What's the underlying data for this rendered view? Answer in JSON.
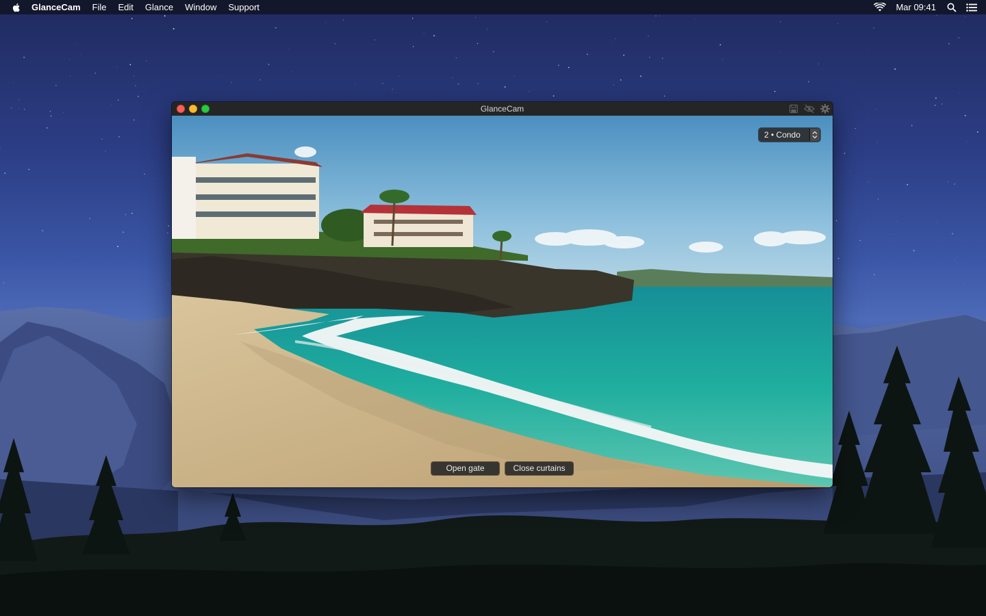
{
  "menubar": {
    "app_name": "GlanceCam",
    "items": [
      "File",
      "Edit",
      "Glance",
      "Window",
      "Support"
    ],
    "clock": "Mar 09:41",
    "icons": [
      "apple-icon",
      "wifi-icon",
      "spotlight-search-icon",
      "notification-center-icon"
    ]
  },
  "window": {
    "title": "GlanceCam",
    "toolbar_icons": [
      "save-icon",
      "hide-icon",
      "settings-gear-icon"
    ],
    "camera_select": {
      "selected": "2 • Condo"
    },
    "buttons": {
      "open_gate": "Open gate",
      "close_curtains": "Close curtains"
    }
  },
  "colors": {
    "menubar_bg": "#121628",
    "titlebar_bg": "#252525",
    "traffic_close": "#fd5f57",
    "traffic_min": "#febc2e",
    "traffic_zoom": "#29c941",
    "hud_button_bg": "#282828"
  }
}
